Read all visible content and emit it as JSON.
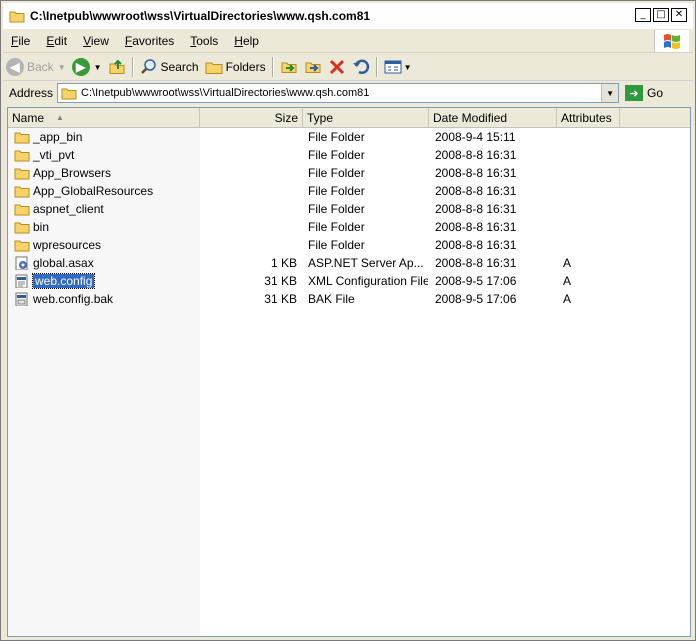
{
  "window": {
    "title": "C:\\Inetpub\\wwwroot\\wss\\VirtualDirectories\\www.qsh.com81"
  },
  "menu": [
    {
      "label": "File",
      "key": "F",
      "rest": "ile"
    },
    {
      "label": "Edit",
      "key": "E",
      "rest": "dit"
    },
    {
      "label": "View",
      "key": "V",
      "rest": "iew"
    },
    {
      "label": "Favorites",
      "key": "F",
      "rest": "avorites"
    },
    {
      "label": "Tools",
      "key": "T",
      "rest": "ools"
    },
    {
      "label": "Help",
      "key": "H",
      "rest": "elp"
    }
  ],
  "toolbar": {
    "back_label": "Back",
    "search_label": "Search",
    "folders_label": "Folders"
  },
  "address": {
    "label": "Address",
    "path": "C:\\Inetpub\\wwwroot\\wss\\VirtualDirectories\\www.qsh.com81",
    "go_label": "Go"
  },
  "columns": {
    "name": "Name",
    "size": "Size",
    "type": "Type",
    "date": "Date Modified",
    "attributes": "Attributes"
  },
  "files": [
    {
      "name": "_app_bin",
      "size": "",
      "type": "File Folder",
      "date": "2008-9-4 15:11",
      "attr": "",
      "icon": "folder"
    },
    {
      "name": "_vti_pvt",
      "size": "",
      "type": "File Folder",
      "date": "2008-8-8 16:31",
      "attr": "",
      "icon": "folder"
    },
    {
      "name": "App_Browsers",
      "size": "",
      "type": "File Folder",
      "date": "2008-8-8 16:31",
      "attr": "",
      "icon": "folder"
    },
    {
      "name": "App_GlobalResources",
      "size": "",
      "type": "File Folder",
      "date": "2008-8-8 16:31",
      "attr": "",
      "icon": "folder"
    },
    {
      "name": "aspnet_client",
      "size": "",
      "type": "File Folder",
      "date": "2008-8-8 16:31",
      "attr": "",
      "icon": "folder"
    },
    {
      "name": "bin",
      "size": "",
      "type": "File Folder",
      "date": "2008-8-8 16:31",
      "attr": "",
      "icon": "folder"
    },
    {
      "name": "wpresources",
      "size": "",
      "type": "File Folder",
      "date": "2008-8-8 16:31",
      "attr": "",
      "icon": "folder"
    },
    {
      "name": "global.asax",
      "size": "1 KB",
      "type": "ASP.NET Server Ap...",
      "date": "2008-8-8 16:31",
      "attr": "A",
      "icon": "asax"
    },
    {
      "name": "web.config",
      "size": "31 KB",
      "type": "XML Configuration File",
      "date": "2008-9-5 17:06",
      "attr": "A",
      "icon": "config",
      "selected": true
    },
    {
      "name": "web.config.bak",
      "size": "31 KB",
      "type": "BAK File",
      "date": "2008-9-5 17:06",
      "attr": "A",
      "icon": "bak"
    }
  ]
}
